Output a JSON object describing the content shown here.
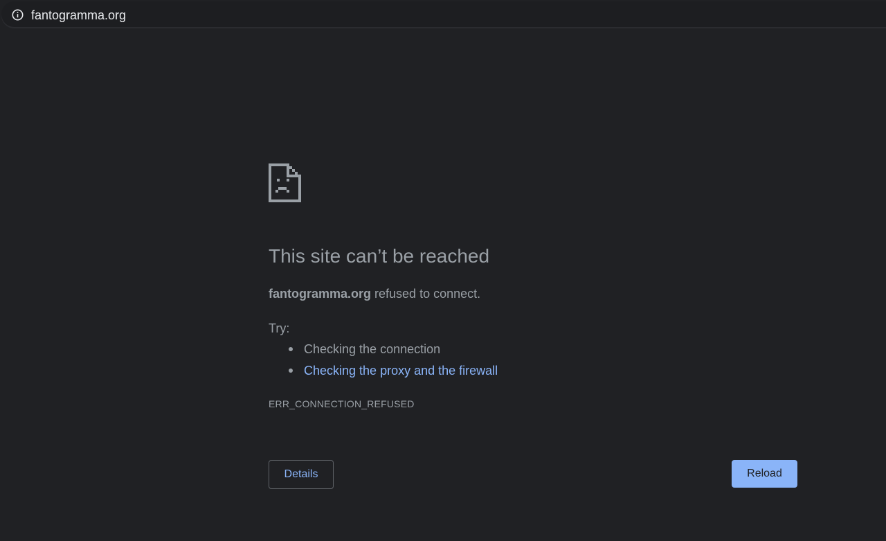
{
  "browser": {
    "url": "fantogramma.org",
    "info_icon": "info-circle-icon"
  },
  "error_page": {
    "icon": "sad-document-icon",
    "title": "This site can’t be reached",
    "host": "fantogramma.org",
    "message_suffix": " refused to connect.",
    "try_label": "Try:",
    "suggestions": [
      {
        "text": "Checking the connection",
        "is_link": false
      },
      {
        "text": "Checking the proxy and the firewall",
        "is_link": true
      }
    ],
    "error_code": "ERR_CONNECTION_REFUSED",
    "details_label": "Details",
    "reload_label": "Reload"
  },
  "colors": {
    "background": "#202124",
    "text": "#9aa0a6",
    "link": "#8ab4f8",
    "primary_button": "#8ab4f8"
  }
}
